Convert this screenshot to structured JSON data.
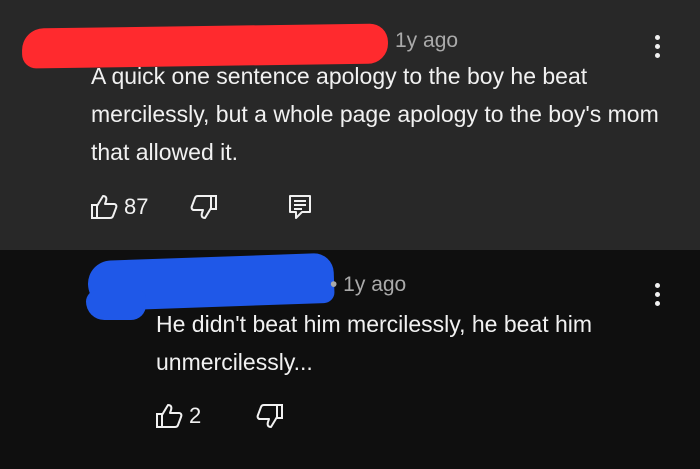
{
  "comments": [
    {
      "time": "1y ago",
      "text": "A quick one sentence apology to the boy he beat mercilessly, but a whole page apology to the boy's mom that allowed it.",
      "likes": "87"
    },
    {
      "time": "• 1y ago",
      "text": "He didn't beat him mercilessly, he beat him unmercilessly...",
      "likes": "2"
    }
  ],
  "colors": {
    "comment_bg_highlight": "#282828",
    "page_bg": "#0f0f0f",
    "redaction_red": "#ff2a2e",
    "redaction_blue": "#1f58e8",
    "meta_text": "#aaaaaa"
  },
  "icons": [
    "thumbs-up-icon",
    "thumbs-down-icon",
    "reply-icon",
    "more-vert-icon"
  ]
}
